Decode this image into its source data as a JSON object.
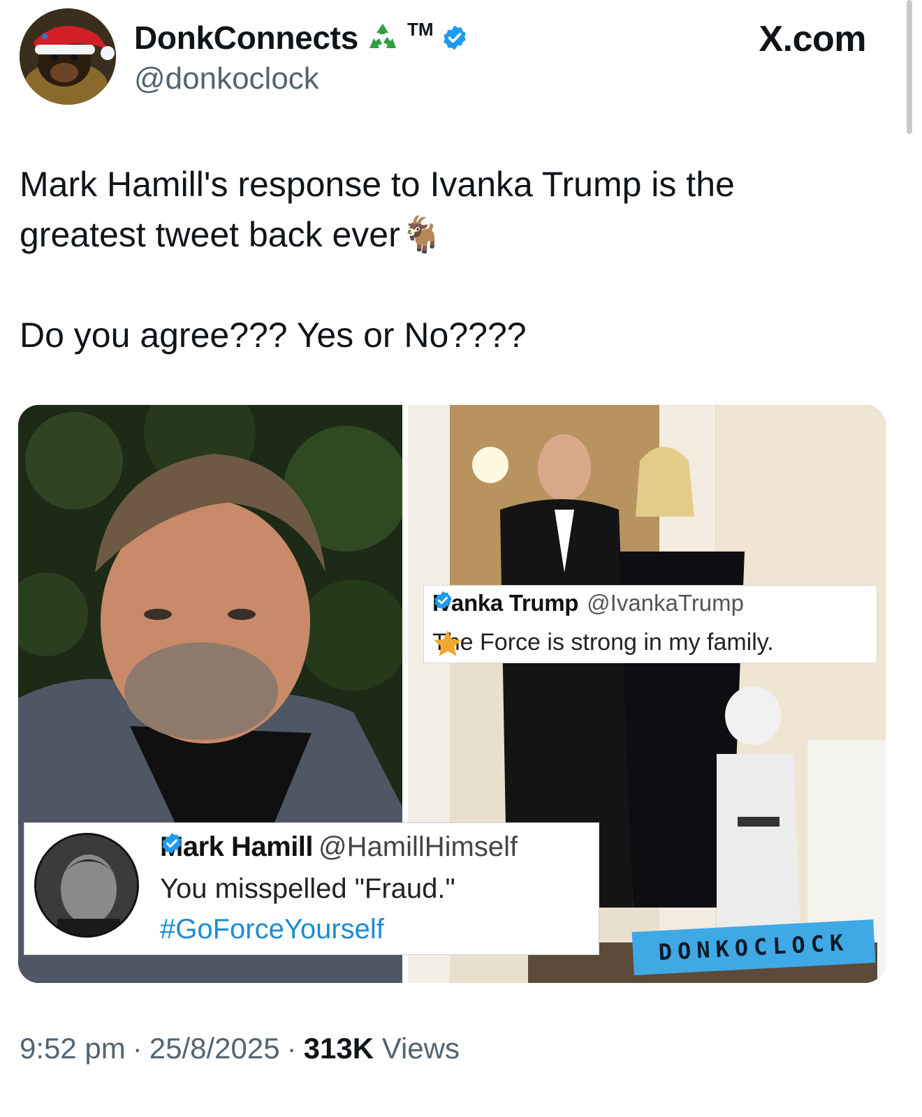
{
  "author": {
    "display_name": "DonkConnects",
    "trademark": "TM",
    "handle": "@donkoclock",
    "verified_color": "#1d9bf0",
    "badges": [
      "recycle-icon",
      "verified-badge-icon"
    ]
  },
  "site_label": "X.com",
  "tweet": {
    "line1": "Mark Hamill's response to Ivanka Trump is the",
    "line2": "greatest tweet back ever",
    "emoji": "🐐",
    "line3": "Do you agree??? Yes or No????"
  },
  "media": {
    "hamill_card": {
      "name": "Mark Hamill",
      "handle": "@HamillHimself",
      "text": "You misspelled \"Fraud.\"",
      "hashtag": "#GoForceYourself",
      "hashtag_color": "#1d8ccf"
    },
    "ivanka_card": {
      "name": "Ivanka Trump",
      "handle": "@IvankaTrump",
      "text": "The Force is strong in my family.",
      "star_color": "#f0a830"
    },
    "watermark": "DONKOCLOCK",
    "watermark_color": "#3fa9e6"
  },
  "meta": {
    "time": "9:52 pm",
    "separator": "·",
    "date": "25/8/2025",
    "views_count": "313K",
    "views_label": "Views"
  }
}
